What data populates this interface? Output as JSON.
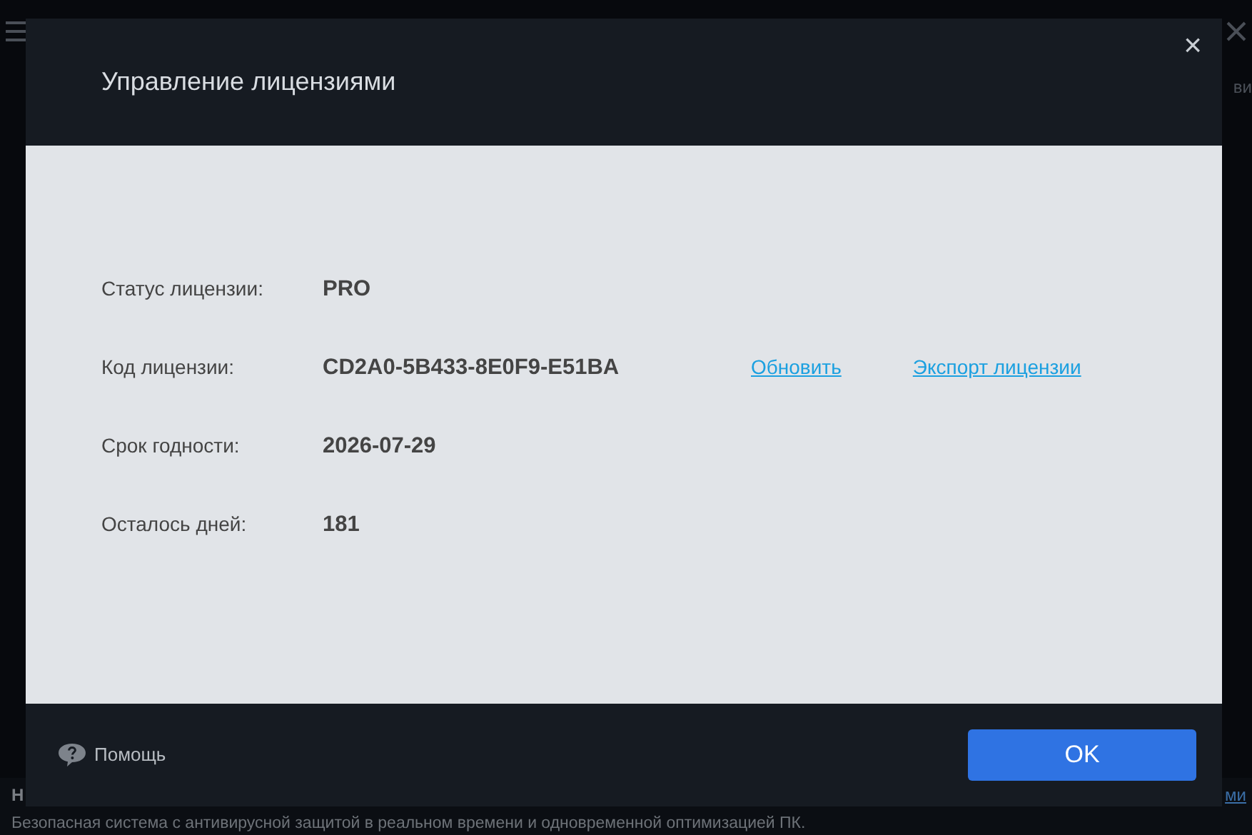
{
  "background": {
    "section_title": "Н",
    "side_tab": "ви",
    "link": "ми",
    "description": "Безопасная система с антивирусной защитой в реальном времени и одновременной оптимизацией ПК."
  },
  "dialog": {
    "title": "Управление лицензиями",
    "close": "×",
    "rows": [
      {
        "label": "Статус лицензии:",
        "value": "PRO"
      },
      {
        "label": "Код лицензии:",
        "value": "CD2A0-5B433-8E0F9-E51BA",
        "links": [
          "Обновить",
          "Экспорт лицензии"
        ]
      },
      {
        "label": "Срок годности:",
        "value": "2026-07-29"
      },
      {
        "label": "Осталось дней:",
        "value": "181"
      }
    ],
    "help": "Помощь",
    "ok": "OK"
  }
}
